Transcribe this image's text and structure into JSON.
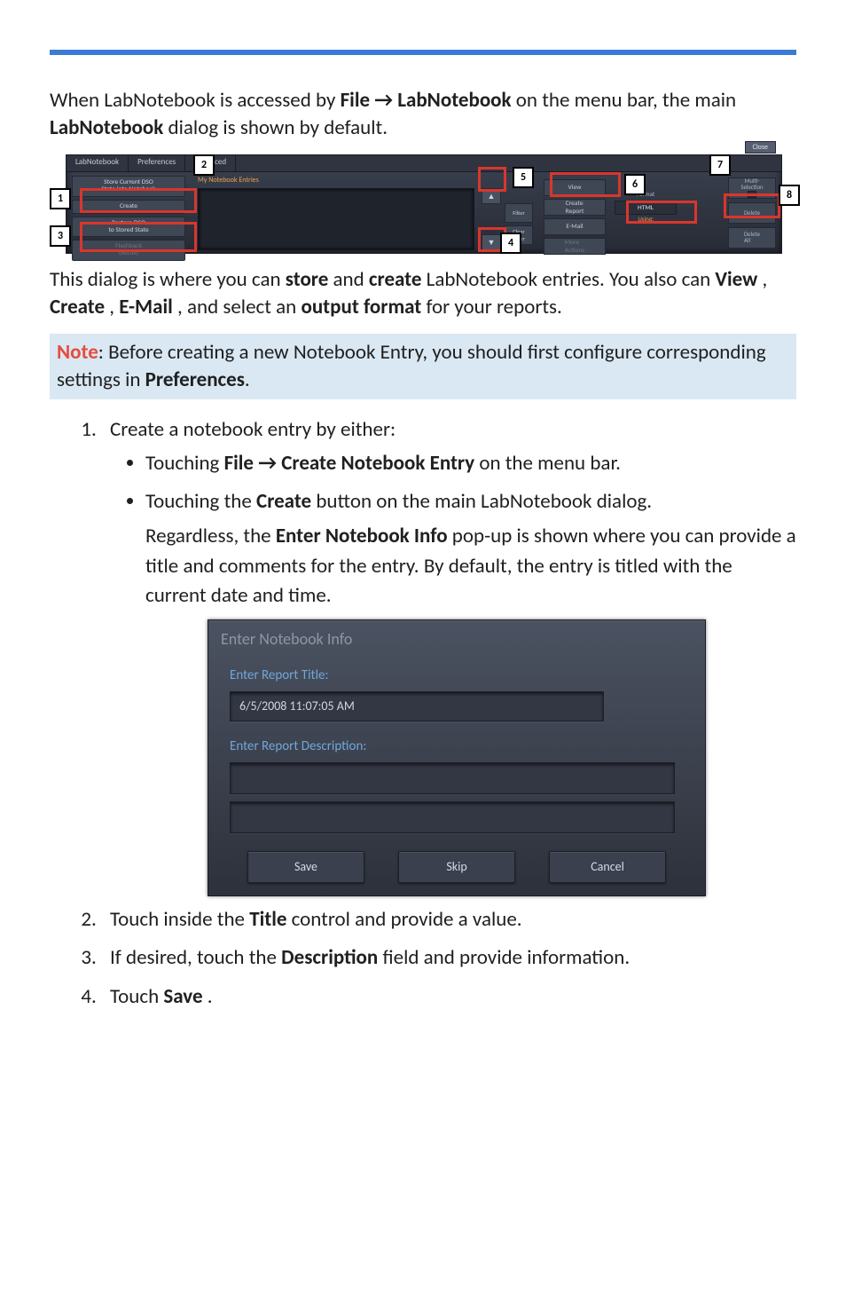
{
  "intro": {
    "p1_a": "When LabNotebook is accessed by ",
    "p1_b": "File → LabNotebook",
    "p1_c": " on the menu bar, the main ",
    "p1_d": "LabNotebook",
    "p1_e": " dialog is shown by default."
  },
  "dialog1": {
    "tabs": {
      "t1": "LabNotebook",
      "t2": "Preferences",
      "t3": "Advanced"
    },
    "left": {
      "store": "Store Current DSO\nState into Notebook",
      "create": "Create",
      "restore": "Restore DSO\nto Stored State",
      "flashback": "Flashback\n(Recall)"
    },
    "entries_label": "My Notebook Entries",
    "filter": {
      "filter": "Filter",
      "clear": "Clear\nFilter"
    },
    "scroll_up": "▲",
    "scroll_down": "▼",
    "mid": {
      "view": "View",
      "create_report": "Create\nReport",
      "email": "E-Mail",
      "more": "More\nActions"
    },
    "using_label": "Using:",
    "format_label": "Format",
    "format_value": "HTML",
    "close": "Close",
    "right": {
      "multi_a": "Multi-",
      "multi_b": "Selection",
      "delete": "Delete",
      "delete_all": "Delete\nAll"
    },
    "callouts": {
      "c1": "1",
      "c2": "2",
      "c3": "3",
      "c4": "4",
      "c5": "5",
      "c6": "6",
      "c7": "7",
      "c8": "8"
    }
  },
  "after_dialog1": {
    "a": "This dialog is where you can ",
    "b": "store",
    "c": " and ",
    "d": "create",
    "e": " LabNotebook entries. You also can ",
    "f": "View",
    "g": ", ",
    "h": "Create",
    "i": ", ",
    "j": "E-Mail",
    "k": ", and select an ",
    "l": "output format",
    "m": " for your reports."
  },
  "note": {
    "label": "Note",
    "a": ": Before creating a new Notebook Entry, you should first configure corresponding settings in ",
    "b": "Preferences",
    "c": "."
  },
  "steps": {
    "s1": "Create a notebook entry by either:",
    "b1_a": "Touching ",
    "b1_b": "File → Create Notebook Entry",
    "b1_c": " on the menu bar.",
    "b2_a": "Touching the ",
    "b2_b": "Create",
    "b2_c": " button on the main LabNotebook dialog.",
    "after_a": "Regardless, the  ",
    "after_b": "Enter Notebook Info",
    "after_c": " pop-up is shown where you can provide a title and comments for the entry. By default, the entry is titled with the current date and time.",
    "s2_a": "Touch inside the ",
    "s2_b": "Title",
    "s2_c": " control and provide a value.",
    "s3_a": "If desired, touch the ",
    "s3_b": "Description",
    "s3_c": " field and provide information.",
    "s4_a": "Touch ",
    "s4_b": "Save",
    "s4_c": "."
  },
  "dialog2": {
    "title": "Enter Notebook Info",
    "report_title_label": "Enter Report Title:",
    "report_title_value": "6/5/2008 11:07:05 AM",
    "report_desc_label": "Enter Report Description:",
    "buttons": {
      "save": "Save",
      "skip": "Skip",
      "cancel": "Cancel"
    }
  }
}
